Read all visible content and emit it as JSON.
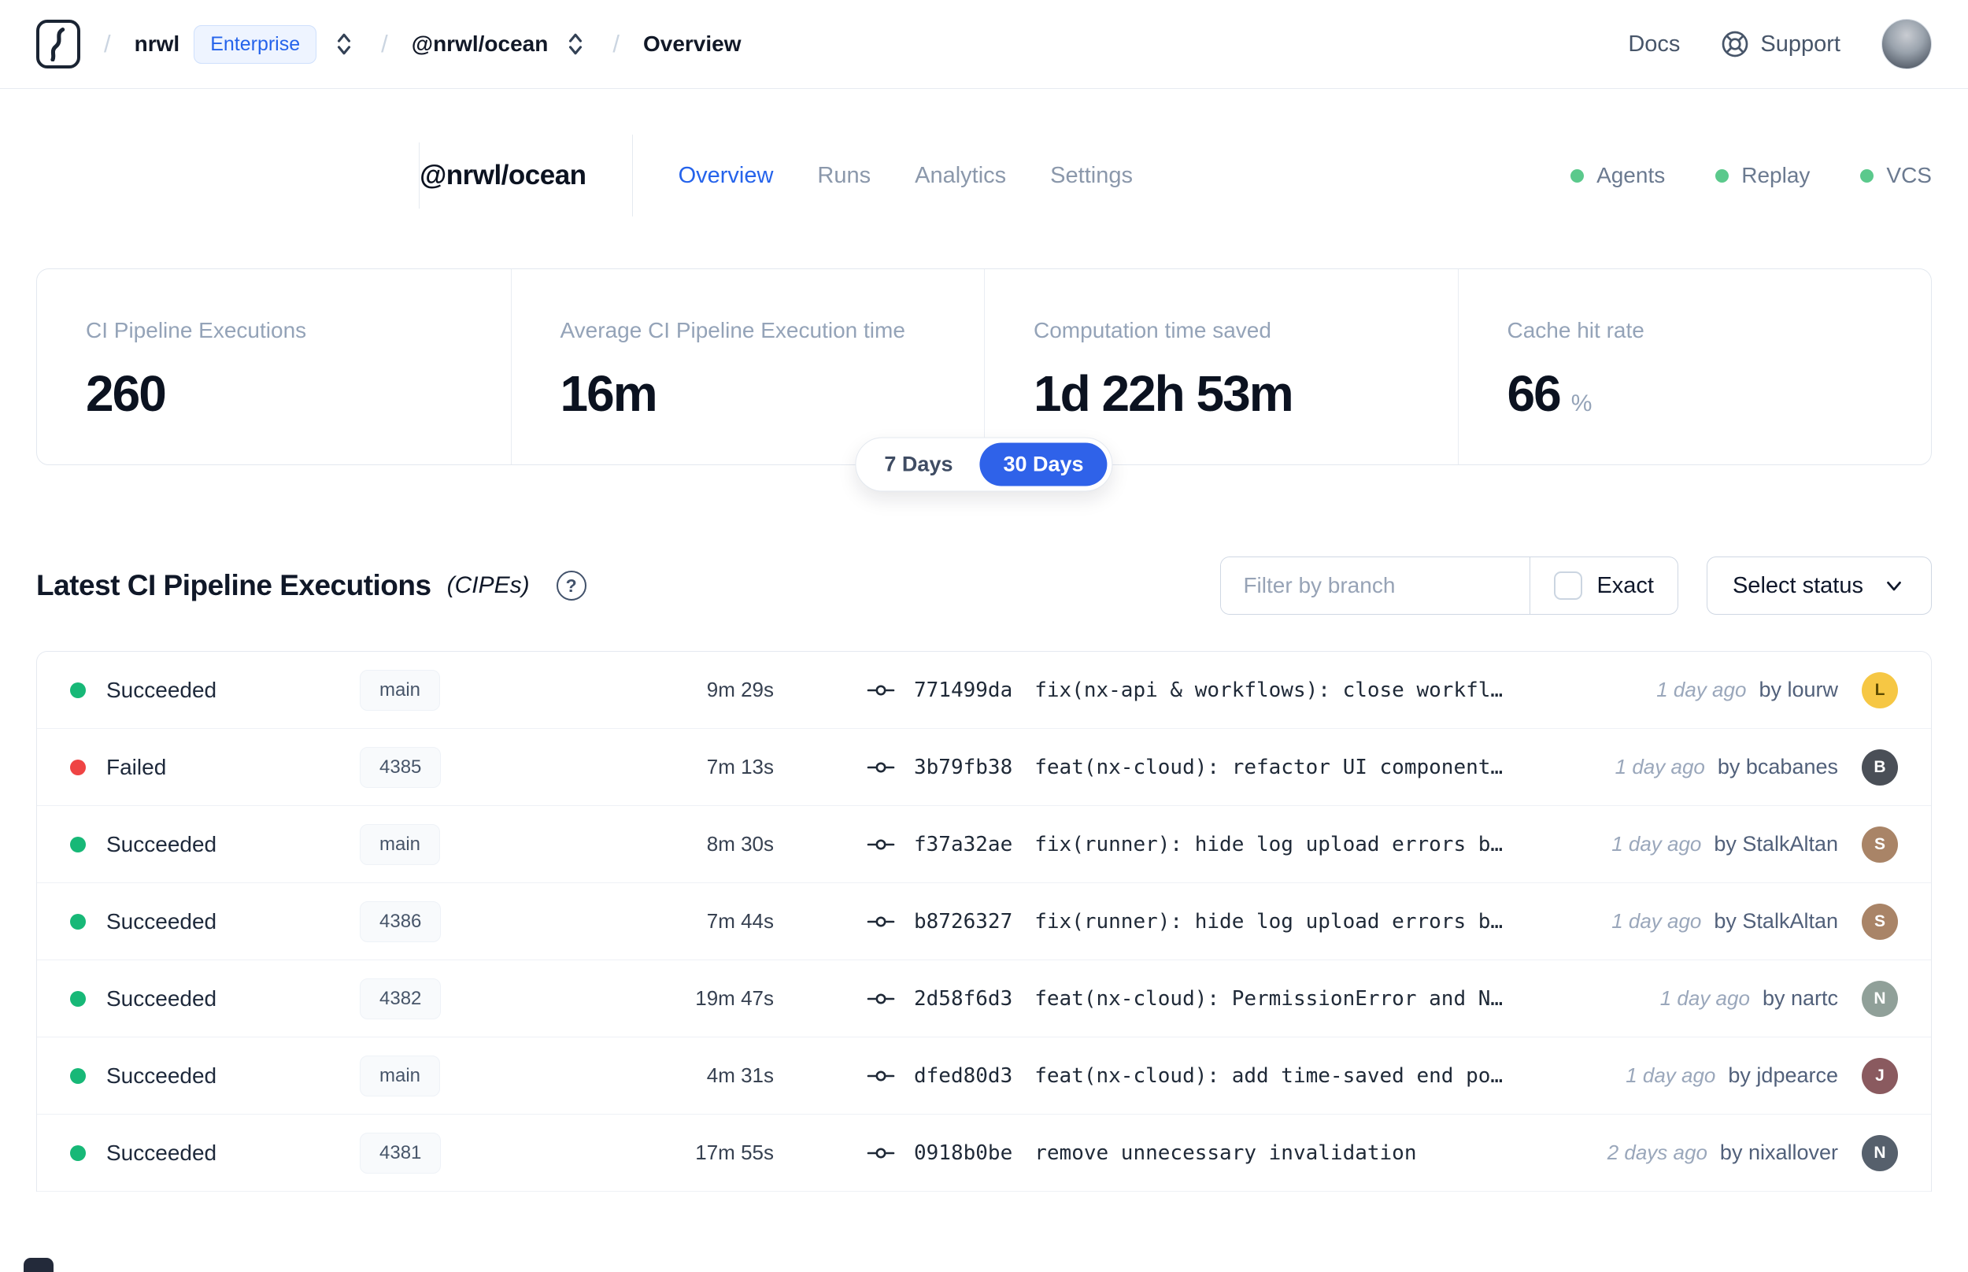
{
  "navbar": {
    "separator": "/",
    "breadcrumb": {
      "org": "nrwl",
      "org_badge": "Enterprise",
      "workspace": "@nrwl/ocean",
      "page": "Overview"
    },
    "docs_label": "Docs",
    "support_label": "Support"
  },
  "workspace_header": {
    "title": "@nrwl/ocean",
    "tabs": [
      {
        "label": "Overview",
        "state": "active"
      },
      {
        "label": "Runs",
        "state": "inactive"
      },
      {
        "label": "Analytics",
        "state": "inactive"
      },
      {
        "label": "Settings",
        "state": "inactive"
      }
    ],
    "services": [
      {
        "label": "Agents",
        "state": "online"
      },
      {
        "label": "Replay",
        "state": "online"
      },
      {
        "label": "VCS",
        "state": "online"
      }
    ]
  },
  "metrics": {
    "cards": [
      {
        "label": "CI Pipeline Executions",
        "value": "260",
        "suffix": ""
      },
      {
        "label": "Average CI Pipeline Execution time",
        "value": "16m",
        "suffix": ""
      },
      {
        "label": "Computation time saved",
        "value": "1d 22h 53m",
        "suffix": ""
      },
      {
        "label": "Cache hit rate",
        "value": "66",
        "suffix": "%"
      }
    ],
    "range_toggle": [
      {
        "label": "7 Days",
        "state": "inactive"
      },
      {
        "label": "30 Days",
        "state": "active"
      }
    ]
  },
  "cipes": {
    "title": "Latest CI Pipeline Executions",
    "title_suffix": "(CIPEs)",
    "help_glyph": "?",
    "filter_placeholder": "Filter by branch",
    "exact_label": "Exact",
    "exact_checked": false,
    "status_select_label": "Select status",
    "rows": [
      {
        "status": "Succeeded",
        "state": "succeeded",
        "branch": "main",
        "duration": "9m 29s",
        "commit_hash": "771499da",
        "commit_message": "fix(nx-api & workflows): close workfl…",
        "time_ago": "1 day ago",
        "author": "by lourw",
        "avatar_initial": "L",
        "avatar_bg": "#f6c744",
        "avatar_fg": "#5b4a00"
      },
      {
        "status": "Failed",
        "state": "failed",
        "branch": "4385",
        "duration": "7m 13s",
        "commit_hash": "3b79fb38",
        "commit_message": "feat(nx-cloud): refactor UI component…",
        "time_ago": "1 day ago",
        "author": "by bcabanes",
        "avatar_initial": "B",
        "avatar_bg": "#4a4f57",
        "avatar_fg": "#ffffff"
      },
      {
        "status": "Succeeded",
        "state": "succeeded",
        "branch": "main",
        "duration": "8m 30s",
        "commit_hash": "f37a32ae",
        "commit_message": "fix(runner): hide log upload errors b…",
        "time_ago": "1 day ago",
        "author": "by StalkAltan",
        "avatar_initial": "S",
        "avatar_bg": "#a98467",
        "avatar_fg": "#ffffff"
      },
      {
        "status": "Succeeded",
        "state": "succeeded",
        "branch": "4386",
        "duration": "7m 44s",
        "commit_hash": "b8726327",
        "commit_message": "fix(runner): hide log upload errors b…",
        "time_ago": "1 day ago",
        "author": "by StalkAltan",
        "avatar_initial": "S",
        "avatar_bg": "#a98467",
        "avatar_fg": "#ffffff"
      },
      {
        "status": "Succeeded",
        "state": "succeeded",
        "branch": "4382",
        "duration": "19m 47s",
        "commit_hash": "2d58f6d3",
        "commit_message": "feat(nx-cloud): PermissionError and N…",
        "time_ago": "1 day ago",
        "author": "by nartc",
        "avatar_initial": "N",
        "avatar_bg": "#90a099",
        "avatar_fg": "#ffffff"
      },
      {
        "status": "Succeeded",
        "state": "succeeded",
        "branch": "main",
        "duration": "4m 31s",
        "commit_hash": "dfed80d3",
        "commit_message": "feat(nx-cloud): add time-saved end po…",
        "time_ago": "1 day ago",
        "author": "by jdpearce",
        "avatar_initial": "J",
        "avatar_bg": "#8a5a5f",
        "avatar_fg": "#ffffff"
      },
      {
        "status": "Succeeded",
        "state": "succeeded",
        "branch": "4381",
        "duration": "17m 55s",
        "commit_hash": "0918b0be",
        "commit_message": "remove unnecessary invalidation",
        "time_ago": "2 days ago",
        "author": "by nixallover",
        "avatar_initial": "N",
        "avatar_bg": "#56606c",
        "avatar_fg": "#ffffff"
      }
    ]
  },
  "colors": {
    "accent_blue": "#2563eb",
    "toggle_blue": "#2f62e9",
    "success_green": "#17b877",
    "fail_red": "#ef4444",
    "service_green": "#5bc98c"
  }
}
